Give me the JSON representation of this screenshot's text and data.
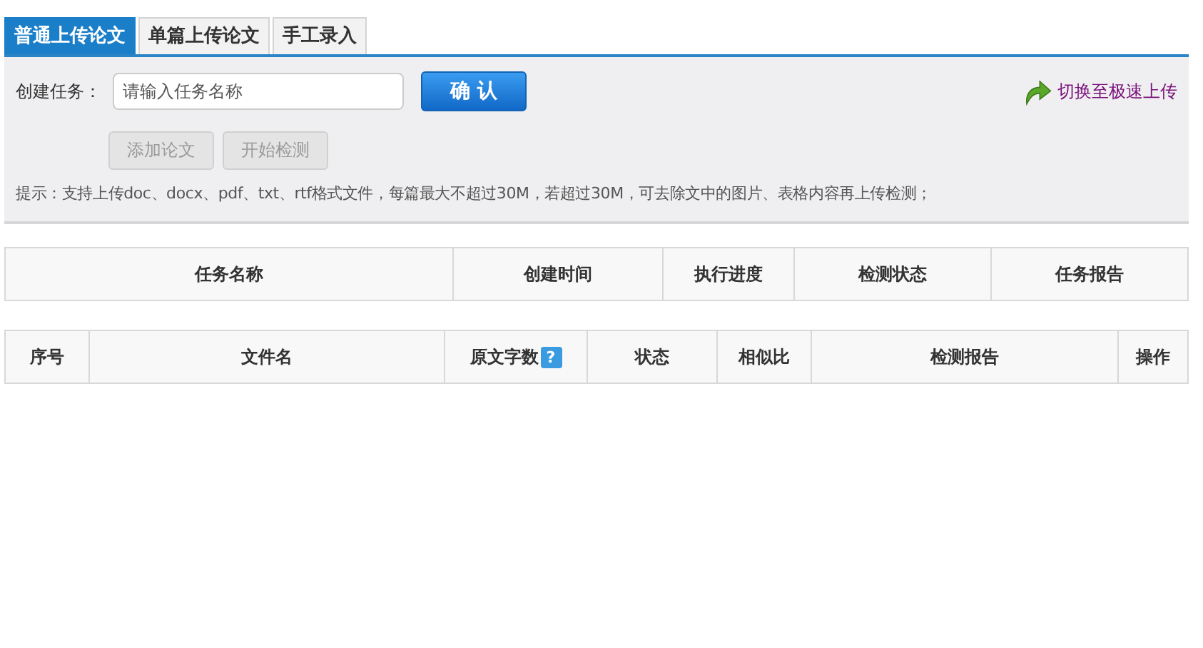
{
  "tabs": [
    {
      "label": "普通上传论文",
      "selected": true
    },
    {
      "label": "单篇上传论文",
      "selected": false
    },
    {
      "label": "手工录入",
      "selected": false
    }
  ],
  "create_task": {
    "label": "创建任务：",
    "placeholder": "请输入任务名称",
    "confirm": "确 认"
  },
  "switch_link": "切换至极速上传",
  "actions": [
    {
      "label": "添加论文",
      "disabled": true
    },
    {
      "label": "开始检测",
      "disabled": true
    }
  ],
  "hint": "提示：支持上传doc、docx、pdf、txt、rtf格式文件，每篇最大不超过30M，若超过30M，可去除文中的图片、表格内容再上传检测；",
  "task_table": {
    "columns": [
      {
        "label": "任务名称"
      },
      {
        "label": "创建时间"
      },
      {
        "label": "执行进度"
      },
      {
        "label": "检测状态"
      },
      {
        "label": "任务报告"
      }
    ]
  },
  "file_table": {
    "columns": [
      {
        "label": "序号"
      },
      {
        "label": "文件名"
      },
      {
        "label": "原文字数",
        "help": "?"
      },
      {
        "label": "状态"
      },
      {
        "label": "相似比"
      },
      {
        "label": "检测报告"
      },
      {
        "label": "操作"
      }
    ]
  }
}
